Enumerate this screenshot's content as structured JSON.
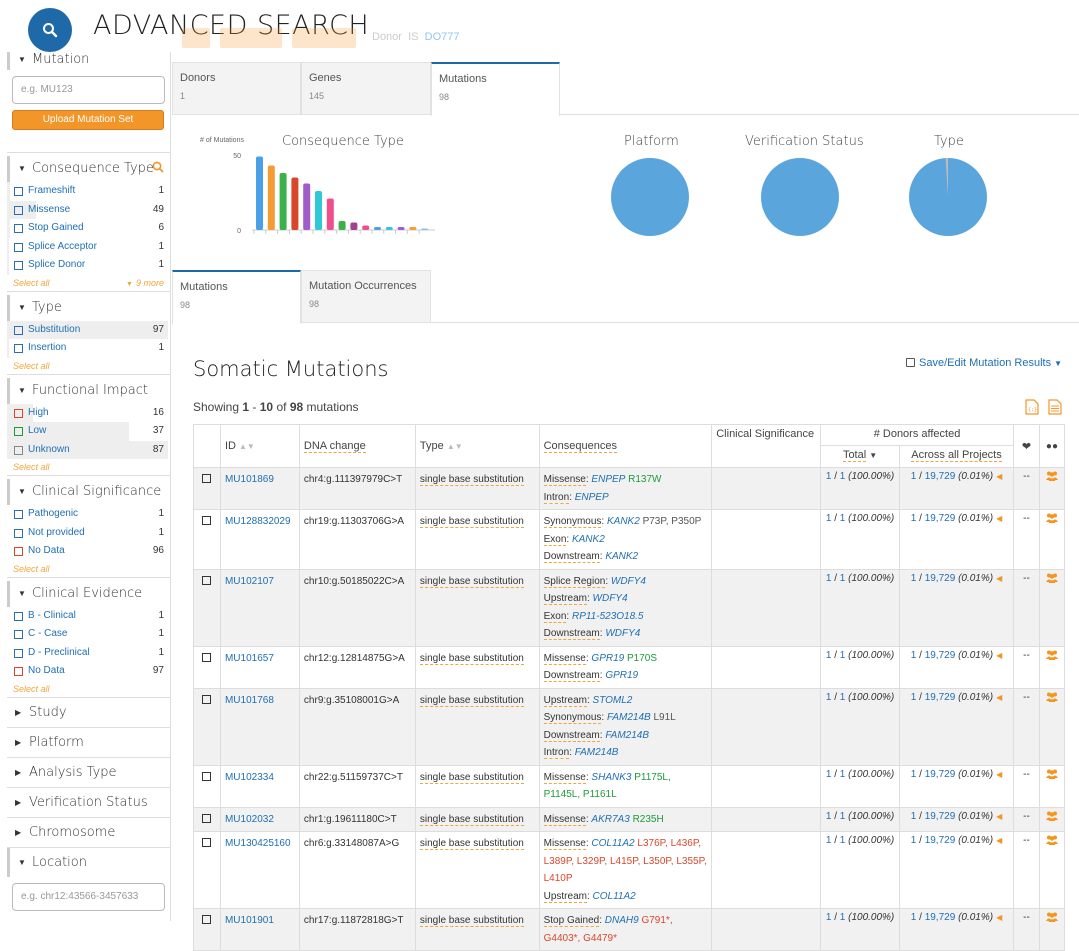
{
  "header": {
    "title": "ADVANCED SEARCH",
    "donor_filter_label": "Donor",
    "donor_filter_is": "IS",
    "donor_filter_value": "DO777"
  },
  "sidebar": {
    "mutation": {
      "title": "Mutation",
      "input_placeholder": "e.g. MU123",
      "upload_label": "Upload Mutation Set"
    },
    "consequence_type": {
      "title": "Consequence Type",
      "items": [
        {
          "label": "Frameshift",
          "count": "1",
          "fill": 0.02
        },
        {
          "label": "Missense",
          "count": "49",
          "fill": 0.18
        },
        {
          "label": "Stop Gained",
          "count": "6",
          "fill": 0.02
        },
        {
          "label": "Splice Acceptor",
          "count": "1",
          "fill": 0.01
        },
        {
          "label": "Splice Donor",
          "count": "1",
          "fill": 0.01
        }
      ],
      "select_all": "Select all",
      "more": "9 more"
    },
    "type": {
      "title": "Type",
      "items": [
        {
          "label": "Substitution",
          "count": "97",
          "fill": 0.99
        },
        {
          "label": "Insertion",
          "count": "1",
          "fill": 0.01
        }
      ],
      "select_all": "Select all"
    },
    "functional_impact": {
      "title": "Functional Impact",
      "items": [
        {
          "label": "High",
          "count": "16",
          "color": "#d9472b",
          "fill": 0.16
        },
        {
          "label": "Low",
          "count": "37",
          "color": "#1d9b3a",
          "fill": 0.75
        },
        {
          "label": "Unknown",
          "count": "87",
          "color": "#888888",
          "fill": 0.99
        }
      ],
      "select_all": "Select all"
    },
    "clinical_significance": {
      "title": "Clinical Significance",
      "items": [
        {
          "label": "Pathogenic",
          "count": "1",
          "color": "#2b6eb5"
        },
        {
          "label": "Not provided",
          "count": "1",
          "color": "#2b6eb5"
        },
        {
          "label": "No Data",
          "count": "96",
          "color": "#d9472b"
        }
      ],
      "select_all": "Select all"
    },
    "clinical_evidence": {
      "title": "Clinical Evidence",
      "items": [
        {
          "label": "B - Clinical",
          "count": "1",
          "color": "#2b6eb5"
        },
        {
          "label": "C - Case",
          "count": "1",
          "color": "#2b6eb5"
        },
        {
          "label": "D - Preclinical",
          "count": "1",
          "color": "#2b6eb5"
        },
        {
          "label": "No Data",
          "count": "97",
          "color": "#d9472b"
        }
      ],
      "select_all": "Select all"
    },
    "closed_facets": [
      "Study",
      "Platform",
      "Analysis Type",
      "Verification Status",
      "Chromosome"
    ],
    "location": {
      "title": "Location",
      "input_placeholder": "e.g. chr12:43566-3457633"
    }
  },
  "tabs": [
    {
      "label": "Donors",
      "count": "1"
    },
    {
      "label": "Genes",
      "count": "145"
    },
    {
      "label": "Mutations",
      "count": "98"
    }
  ],
  "charts": {
    "consequence": {
      "title": "Consequence Type",
      "ylabel": "# of Mutations"
    },
    "platform": {
      "title": "Platform"
    },
    "verification": {
      "title": "Verification Status"
    },
    "type": {
      "title": "Type"
    }
  },
  "chart_data": {
    "type": "bar",
    "title": "Consequence Type",
    "ylabel": "# of Mutations",
    "ylim": [
      0,
      50
    ],
    "yticks": [
      0,
      50
    ],
    "values": [
      49,
      43,
      38,
      35,
      31,
      26,
      21,
      6,
      5,
      3,
      2,
      2,
      2,
      2,
      1
    ],
    "colors": [
      "#4aa0e6",
      "#f49b33",
      "#3cb04a",
      "#d9472b",
      "#a05cc7",
      "#2ec8d8",
      "#ef4f8b",
      "#3cb04a",
      "#a0438f",
      "#ef4f8b",
      "#4aa0e6",
      "#2ec8d8",
      "#a05cc7",
      "#f49b33",
      "#7ec7e7"
    ]
  },
  "subtabs": [
    {
      "label": "Mutations",
      "count": "98"
    },
    {
      "label": "Mutation Occurrences",
      "count": "98"
    }
  ],
  "results": {
    "title": "Somatic Mutations",
    "save_label": "Save/Edit Mutation Results",
    "showing_prefix": "Showing",
    "showing_range_start": "1",
    "showing_range_sep": "-",
    "showing_range_end": "10",
    "showing_of": "of",
    "showing_total": "98",
    "showing_suffix": "mutations",
    "columns": {
      "id": "ID",
      "dna": "DNA change",
      "type": "Type",
      "consequences": "Consequences",
      "clinical": "Clinical Significance",
      "donors_affected": "# Donors affected",
      "total": "Total",
      "across": "Across all Projects"
    },
    "rows": [
      {
        "id": "MU101869",
        "dna": "chr4:g.111397979C>T",
        "type": "single base substitution",
        "consequences": [
          {
            "kind": "Missense",
            "gene": "ENPEP",
            "aa": [
              {
                "t": "R137W",
                "c": "green"
              }
            ]
          },
          {
            "kind": "Intron",
            "gene": "ENPEP",
            "aa": []
          }
        ],
        "total_a": "1",
        "total_b": "1",
        "total_pct": "(100.00%)",
        "across_a": "1",
        "across_b": "19,729",
        "across_pct": "(0.01%)",
        "clin": "--"
      },
      {
        "id": "MU128832029",
        "dna": "chr19:g.11303706G>A",
        "type": "single base substitution",
        "consequences": [
          {
            "kind": "Synonymous",
            "gene": "KANK2",
            "aa": [
              {
                "t": "P73P,",
                "c": "grey"
              },
              {
                "t": "P350P",
                "c": "grey"
              }
            ]
          },
          {
            "kind": "Exon",
            "gene": "KANK2",
            "aa": []
          },
          {
            "kind": "Downstream",
            "gene": "KANK2",
            "aa": []
          }
        ],
        "total_a": "1",
        "total_b": "1",
        "total_pct": "(100.00%)",
        "across_a": "1",
        "across_b": "19,729",
        "across_pct": "(0.01%)",
        "clin": "--"
      },
      {
        "id": "MU102107",
        "dna": "chr10:g.50185022C>A",
        "type": "single base substitution",
        "consequences": [
          {
            "kind": "Splice Region",
            "gene": "WDFY4",
            "aa": []
          },
          {
            "kind": "Upstream",
            "gene": "WDFY4",
            "aa": []
          },
          {
            "kind": "Exon",
            "gene": "RP11-523O18.5",
            "aa": []
          },
          {
            "kind": "Downstream",
            "gene": "WDFY4",
            "aa": []
          }
        ],
        "total_a": "1",
        "total_b": "1",
        "total_pct": "(100.00%)",
        "across_a": "1",
        "across_b": "19,729",
        "across_pct": "(0.01%)",
        "clin": "--"
      },
      {
        "id": "MU101657",
        "dna": "chr12:g.12814875G>A",
        "type": "single base substitution",
        "consequences": [
          {
            "kind": "Missense",
            "gene": "GPR19",
            "aa": [
              {
                "t": "P170S",
                "c": "green"
              }
            ]
          },
          {
            "kind": "Downstream",
            "gene": "GPR19",
            "aa": []
          }
        ],
        "total_a": "1",
        "total_b": "1",
        "total_pct": "(100.00%)",
        "across_a": "1",
        "across_b": "19,729",
        "across_pct": "(0.01%)",
        "clin": "--"
      },
      {
        "id": "MU101768",
        "dna": "chr9:g.35108001G>A",
        "type": "single base substitution",
        "consequences": [
          {
            "kind": "Upstream",
            "gene": "STOML2",
            "aa": []
          },
          {
            "kind": "Synonymous",
            "gene": "FAM214B",
            "aa": [
              {
                "t": "L91L",
                "c": "grey"
              }
            ]
          },
          {
            "kind": "Downstream",
            "gene": "FAM214B",
            "aa": []
          },
          {
            "kind": "Intron",
            "gene": "FAM214B",
            "aa": []
          }
        ],
        "total_a": "1",
        "total_b": "1",
        "total_pct": "(100.00%)",
        "across_a": "1",
        "across_b": "19,729",
        "across_pct": "(0.01%)",
        "clin": "--"
      },
      {
        "id": "MU102334",
        "dna": "chr22:g.51159737C>T",
        "type": "single base substitution",
        "consequences": [
          {
            "kind": "Missense",
            "gene": "SHANK3",
            "aa": [
              {
                "t": "P1175L,",
                "c": "green"
              },
              {
                "t": "P1145L,",
                "c": "green"
              },
              {
                "t": "P1161L",
                "c": "green"
              }
            ]
          }
        ],
        "total_a": "1",
        "total_b": "1",
        "total_pct": "(100.00%)",
        "across_a": "1",
        "across_b": "19,729",
        "across_pct": "(0.01%)",
        "clin": "--"
      },
      {
        "id": "MU102032",
        "dna": "chr1:g.19611180C>T",
        "type": "single base substitution",
        "consequences": [
          {
            "kind": "Missense",
            "gene": "AKR7A3",
            "aa": [
              {
                "t": "R235H",
                "c": "green"
              }
            ]
          }
        ],
        "total_a": "1",
        "total_b": "1",
        "total_pct": "(100.00%)",
        "across_a": "1",
        "across_b": "19,729",
        "across_pct": "(0.01%)",
        "clin": "--"
      },
      {
        "id": "MU130425160",
        "dna": "chr6:g.33148087A>G",
        "type": "single base substitution",
        "consequences": [
          {
            "kind": "Missense",
            "gene": "COL11A2",
            "aa": [
              {
                "t": "L376P,",
                "c": "red"
              },
              {
                "t": "L436P,",
                "c": "red"
              },
              {
                "t": "L389P,",
                "c": "red"
              },
              {
                "t": "L329P,",
                "c": "red"
              },
              {
                "t": "L415P,",
                "c": "red"
              },
              {
                "t": "L350P,",
                "c": "red"
              },
              {
                "t": "L355P,",
                "c": "red"
              },
              {
                "t": "L410P",
                "c": "red"
              }
            ]
          },
          {
            "kind": "Upstream",
            "gene": "COL11A2",
            "aa": []
          }
        ],
        "total_a": "1",
        "total_b": "1",
        "total_pct": "(100.00%)",
        "across_a": "1",
        "across_b": "19,729",
        "across_pct": "(0.01%)",
        "clin": "--"
      },
      {
        "id": "MU101901",
        "dna": "chr17:g.11872818G>T",
        "type": "single base substitution",
        "consequences": [
          {
            "kind": "Stop Gained",
            "gene": "DNAH9",
            "aa": [
              {
                "t": "G791*,",
                "c": "red"
              },
              {
                "t": "G4403*,",
                "c": "red"
              },
              {
                "t": "G4479*",
                "c": "red"
              }
            ]
          }
        ],
        "total_a": "1",
        "total_b": "1",
        "total_pct": "(100.00%)",
        "across_a": "1",
        "across_b": "19,729",
        "across_pct": "(0.01%)",
        "clin": "--"
      }
    ]
  },
  "colors": {
    "accent": "#1e6aa8",
    "orange": "#f3962a",
    "pie": "#5aa5db"
  }
}
